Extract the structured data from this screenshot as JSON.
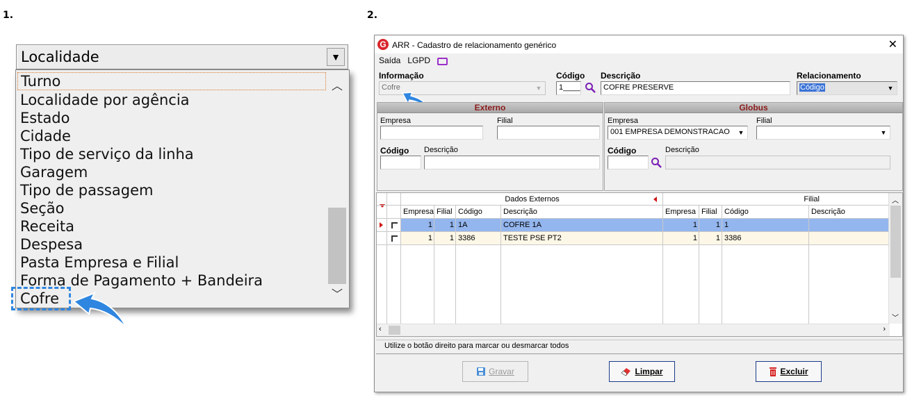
{
  "steps": {
    "one": "1.",
    "two": "2."
  },
  "panel1": {
    "combo_value": "Localidade",
    "items": [
      "Turno",
      "Localidade por agência",
      "Estado",
      "Cidade",
      "Tipo de serviço da linha",
      "Garagem",
      "Tipo de passagem",
      "Seção",
      "Receita",
      "Despesa",
      "Pasta Empresa e Filial",
      "Forma de Pagamento + Bandeira",
      "Cofre"
    ],
    "focused_item": "Turno",
    "highlighted_item": "Cofre"
  },
  "window": {
    "logo": "G",
    "title": "ARR - Cadastro de relacionamento genérico",
    "menu": [
      "Saída",
      "LGPD"
    ],
    "informacao_label": "Informação",
    "informacao_value": "Cofre",
    "codigo_label": "Código",
    "codigo_value": "1____",
    "descricao_label": "Descrição",
    "descricao_value": "COFRE PRESERVE",
    "relacionamento_label": "Relacionamento",
    "relacionamento_value": "Código",
    "externo": {
      "title": "Externo",
      "empresa_label": "Empresa",
      "empresa_value": "",
      "filial_label": "Filial",
      "filial_value": "",
      "codigo_label": "Código",
      "codigo_value": "",
      "descricao_label": "Descrição",
      "descricao_value": ""
    },
    "globus": {
      "title": "Globus",
      "empresa_label": "Empresa",
      "empresa_value": "001 EMPRESA DEMONSTRACAO",
      "filial_label": "Filial",
      "filial_value": "",
      "codigo_label": "Código",
      "codigo_value": "",
      "descricao_label": "Descrição",
      "descricao_value": ""
    },
    "grid": {
      "group_headers": [
        "Dados Externos",
        "Filial"
      ],
      "columns": [
        "Empresa",
        "Filial",
        "Código",
        "Descrição",
        "Empresa",
        "Filial",
        "Código",
        "Descrição"
      ],
      "rows": [
        [
          "1",
          "1",
          "1A",
          "COFRE 1A",
          "1",
          "1",
          "1",
          ""
        ],
        [
          "1",
          "1",
          "3386",
          "TESTE PSE PT2",
          "1",
          "1",
          "3386",
          ""
        ]
      ]
    },
    "status_text": "Utilize o botão direito para marcar ou desmarcar todos",
    "buttons": {
      "gravar": "Gravar",
      "limpar": "Limpar",
      "excluir": "Excluir"
    },
    "colors": {
      "accent_blue": "#2f86e0",
      "header_red": "#8b1a1a",
      "selected_row": "#94b6ee",
      "logo_red": "#d9262c"
    }
  }
}
